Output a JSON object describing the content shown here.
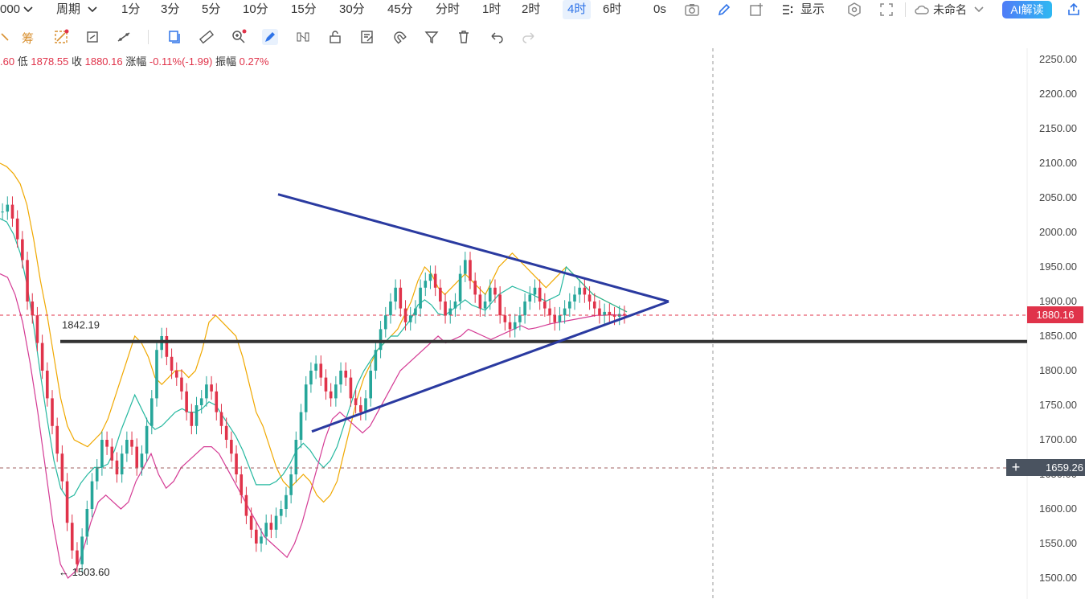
{
  "topbar": {
    "symbol_fragment": "000",
    "period_label": "周期",
    "intervals": [
      "1分",
      "3分",
      "5分",
      "10分",
      "15分",
      "30分",
      "45分",
      "分时",
      "1时",
      "2时",
      "4时",
      "6时"
    ],
    "active_interval": "4时",
    "timer": "0s",
    "display_label": "显示",
    "layout_name": "未命名",
    "ai_button": "AI解读"
  },
  "toolbar": {
    "chip_label": "筹"
  },
  "ohlc": {
    "open_fragment": ".60",
    "low_label": "低",
    "low_value": "1878.55",
    "close_label": "收",
    "close_value": "1880.16",
    "change_label": "涨幅",
    "change_value": "-0.11%(-1.99)",
    "amplitude_label": "振幅",
    "amplitude_value": "0.27%"
  },
  "colors": {
    "up": "#26a69a",
    "down": "#e0334a",
    "boll_upper": "#f0a800",
    "boll_mid": "#26b8a0",
    "boll_lower": "#d43a94",
    "triangle": "#2a3aa0",
    "support": "#333333"
  },
  "chart_data": {
    "type": "candlestick",
    "y_axis_ticks": [
      "2250.00",
      "2200.00",
      "2150.00",
      "2100.00",
      "2050.00",
      "2000.00",
      "1950.00",
      "1900.00",
      "1850.00",
      "1800.00",
      "1750.00",
      "1700.00",
      "1650.00",
      "1600.00",
      "1550.00",
      "1500.00"
    ],
    "ylim": [
      1500,
      2250
    ],
    "last_price": "1880.16",
    "crosshair_price": "1659.26",
    "support_level": "1842.19",
    "support_label": "1842.19",
    "low_marker": "1503.60",
    "triangle": {
      "upper_start": [
        0,
        2055
      ],
      "upper_end": [
        1,
        1900
      ],
      "lower_start": [
        0,
        1712
      ],
      "lower_end": [
        1,
        1900
      ]
    },
    "candles_close": [
      2030,
      2040,
      2020,
      1990,
      1960,
      1900,
      1880,
      1840,
      1800,
      1760,
      1720,
      1680,
      1640,
      1580,
      1540,
      1520,
      1560,
      1600,
      1640,
      1660,
      1700,
      1690,
      1670,
      1650,
      1680,
      1700,
      1690,
      1660,
      1680,
      1720,
      1760,
      1830,
      1850,
      1820,
      1800,
      1790,
      1770,
      1740,
      1720,
      1750,
      1760,
      1780,
      1770,
      1740,
      1720,
      1700,
      1680,
      1650,
      1620,
      1590,
      1570,
      1550,
      1560,
      1580,
      1570,
      1590,
      1600,
      1620,
      1650,
      1700,
      1740,
      1780,
      1800,
      1810,
      1790,
      1770,
      1760,
      1780,
      1800,
      1790,
      1760,
      1750,
      1740,
      1760,
      1800,
      1830,
      1860,
      1880,
      1900,
      1920,
      1890,
      1870,
      1880,
      1890,
      1920,
      1930,
      1940,
      1920,
      1900,
      1880,
      1890,
      1900,
      1940,
      1960,
      1930,
      1910,
      1890,
      1900,
      1920,
      1910,
      1880,
      1870,
      1860,
      1870,
      1880,
      1900,
      1910,
      1920,
      1900,
      1890,
      1880,
      1870,
      1880,
      1890,
      1900,
      1910,
      1920,
      1910,
      1900,
      1890,
      1880,
      1885,
      1880,
      1878,
      1882,
      1880
    ],
    "boll_upper": [
      2100,
      2095,
      2085,
      2070,
      2040,
      1990,
      1930,
      1880,
      1820,
      1760,
      1720,
      1700,
      1695,
      1690,
      1700,
      1710,
      1730,
      1760,
      1790,
      1820,
      1850,
      1840,
      1820,
      1790,
      1780,
      1790,
      1800,
      1800,
      1790,
      1800,
      1830,
      1870,
      1880,
      1870,
      1860,
      1850,
      1820,
      1780,
      1740,
      1720,
      1690,
      1660,
      1640,
      1630,
      1640,
      1650,
      1640,
      1620,
      1610,
      1620,
      1640,
      1680,
      1720,
      1760,
      1790,
      1810,
      1830,
      1840,
      1850,
      1860,
      1880,
      1900,
      1930,
      1950,
      1940,
      1920,
      1910,
      1920,
      1930,
      1940,
      1930,
      1920,
      1910,
      1930,
      1950,
      1960,
      1970,
      1960,
      1950,
      1940,
      1930,
      1920,
      1930,
      1940,
      1950,
      1940,
      1930,
      1920,
      1910,
      1905,
      1900,
      1895,
      1890,
      1885
    ],
    "boll_lower": [
      1940,
      1935,
      1910,
      1870,
      1810,
      1740,
      1660,
      1580,
      1520,
      1500,
      1510,
      1540,
      1580,
      1610,
      1620,
      1610,
      1600,
      1610,
      1640,
      1660,
      1680,
      1650,
      1630,
      1640,
      1660,
      1670,
      1680,
      1690,
      1690,
      1680,
      1660,
      1640,
      1620,
      1600,
      1580,
      1560,
      1550,
      1540,
      1530,
      1550,
      1580,
      1620,
      1660,
      1700,
      1730,
      1740,
      1730,
      1720,
      1710,
      1720,
      1740,
      1760,
      1780,
      1800,
      1810,
      1820,
      1830,
      1840,
      1850,
      1840,
      1845,
      1850,
      1860,
      1855,
      1850,
      1845,
      1850,
      1855,
      1860,
      1865,
      1860,
      1862,
      1865,
      1868,
      1870,
      1872,
      1874,
      1876,
      1878,
      1880,
      1880,
      1881,
      1880,
      1880
    ]
  }
}
